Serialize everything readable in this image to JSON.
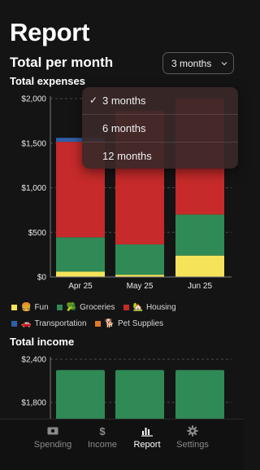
{
  "page": {
    "title": "Report"
  },
  "header": {
    "section_title": "Total per month",
    "period_select_value": "3 months"
  },
  "period_dropdown": {
    "options": [
      {
        "label": "3 months",
        "selected": true
      },
      {
        "label": "6 months",
        "selected": false
      },
      {
        "label": "12 months",
        "selected": false
      }
    ]
  },
  "expenses": {
    "title": "Total expenses"
  },
  "income": {
    "title": "Total income"
  },
  "legend": [
    {
      "label": "Fun",
      "emoji": "🍔",
      "color": "#f5e35a"
    },
    {
      "label": "Groceries",
      "emoji": "🥦",
      "color": "#2f8a56"
    },
    {
      "label": "Housing",
      "emoji": "🏡",
      "color": "#c62a2a"
    },
    {
      "label": "Transportation",
      "emoji": "🚗",
      "color": "#2f5fa8"
    },
    {
      "label": "Pet Supplies",
      "emoji": "🐕",
      "color": "#e07a2a"
    }
  ],
  "chart_data": [
    {
      "type": "bar",
      "stacked": true,
      "title": "Total expenses",
      "categories": [
        "Apr 25",
        "May 25",
        "Jun 25"
      ],
      "ylim": [
        0,
        2000
      ],
      "yticks": [
        "$2,000",
        "$1,500",
        "$1,000",
        "$500",
        "$0"
      ],
      "ytick_values": [
        2000,
        1500,
        1000,
        500,
        0
      ],
      "grid": true,
      "legend_position": "bottom",
      "series": [
        {
          "name": "Fun",
          "color": "#f5e35a",
          "values": [
            60,
            25,
            240
          ]
        },
        {
          "name": "Groceries",
          "color": "#2f8a56",
          "values": [
            385,
            340,
            460
          ]
        },
        {
          "name": "Housing",
          "color": "#c62a2a",
          "values": [
            1070,
            1500,
            1300
          ]
        },
        {
          "name": "Transportation",
          "color": "#2f5fa8",
          "values": [
            45,
            0,
            0
          ]
        },
        {
          "name": "Pet Supplies",
          "color": "#e07a2a",
          "values": [
            0,
            0,
            0
          ]
        }
      ]
    },
    {
      "type": "bar",
      "title": "Total income",
      "categories": [
        "Apr 25",
        "May 25",
        "Jun 25"
      ],
      "ylim_visible": [
        1550,
        2400
      ],
      "yticks": [
        "$2,400",
        "$1,800"
      ],
      "ytick_values": [
        2400,
        1800
      ],
      "grid": true,
      "color": "#2f8a56",
      "values": [
        2250,
        2250,
        2250
      ]
    }
  ],
  "tabbar": {
    "tabs": [
      {
        "label": "Spending",
        "icon": "banknote-icon",
        "active": false
      },
      {
        "label": "Income",
        "icon": "dollar-icon",
        "active": false
      },
      {
        "label": "Report",
        "icon": "chart-icon",
        "active": true
      },
      {
        "label": "Settings",
        "icon": "gear-icon",
        "active": false
      }
    ],
    "income_glyph": "$"
  }
}
